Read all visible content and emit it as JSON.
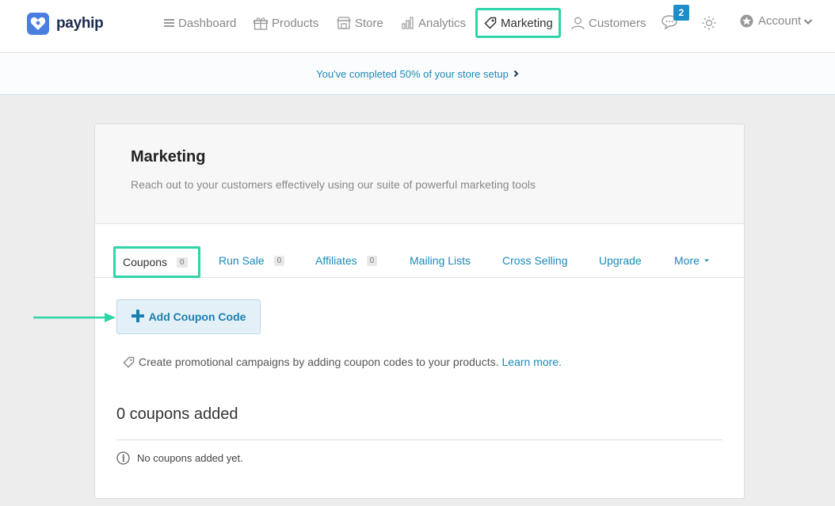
{
  "app": {
    "logo_text": "payhip"
  },
  "nav": {
    "dashboard": "Dashboard",
    "products": "Products",
    "store": "Store",
    "analytics": "Analytics",
    "marketing": "Marketing",
    "customers": "Customers",
    "chat_badge": "2",
    "account": "Account"
  },
  "banner": {
    "text": "You've completed 50% of your store setup",
    "progress_percent": 50
  },
  "card": {
    "title": "Marketing",
    "subtitle": "Reach out to your customers effectively using our suite of powerful marketing tools"
  },
  "tabs": [
    {
      "label": "Coupons",
      "count": "0"
    },
    {
      "label": "Run Sale",
      "count": "0"
    },
    {
      "label": "Affiliates",
      "count": "0"
    },
    {
      "label": "Mailing Lists"
    },
    {
      "label": "Cross Selling"
    },
    {
      "label": "Upgrade"
    },
    {
      "label": "More"
    }
  ],
  "coupons": {
    "add_button": "Add Coupon Code",
    "info_text": "Create promotional campaigns by adding coupon codes to your products.",
    "learn_more": "Learn more.",
    "count_title": "0 coupons added",
    "empty_text": "No coupons added yet."
  },
  "colors": {
    "accent": "#2fd4a8",
    "link": "#1b89b8",
    "brand": "#4a7fe0",
    "badge": "#1d8ec9"
  }
}
